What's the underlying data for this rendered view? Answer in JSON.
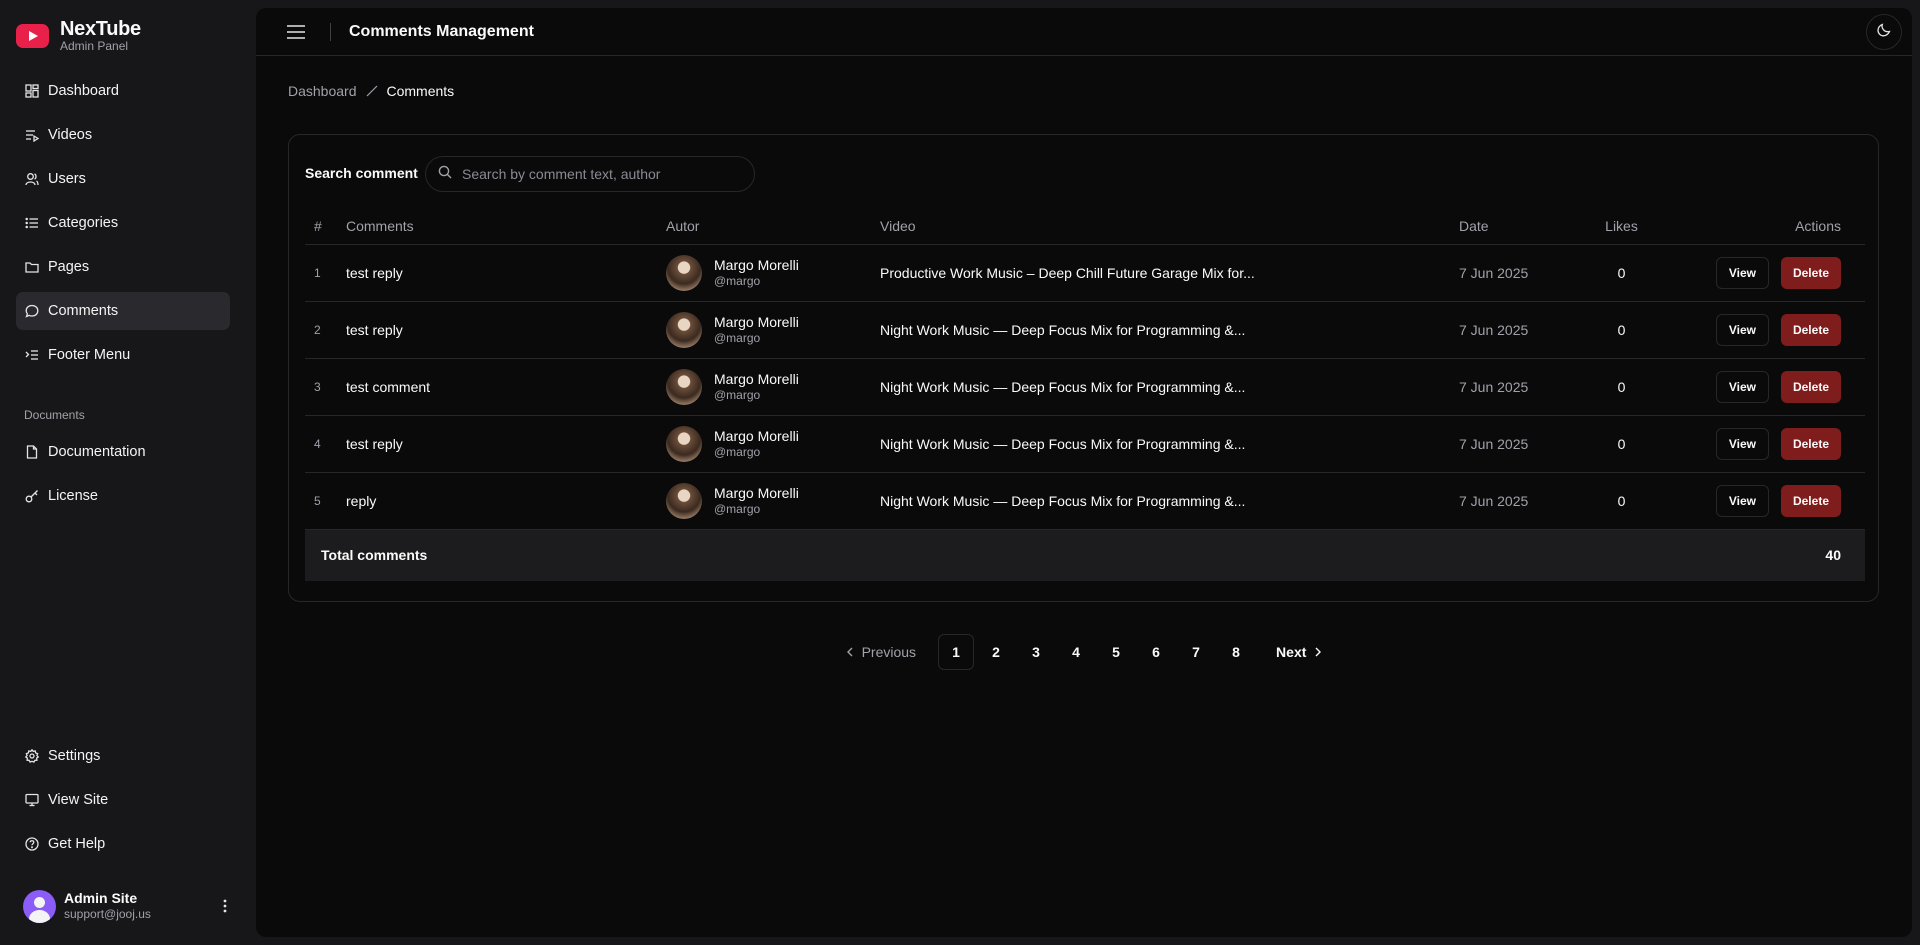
{
  "brand": {
    "name": "NexTube",
    "subtitle": "Admin Panel"
  },
  "sidebar": {
    "items": [
      {
        "label": "Dashboard",
        "icon": "dashboard-icon"
      },
      {
        "label": "Videos",
        "icon": "videos-icon"
      },
      {
        "label": "Users",
        "icon": "users-icon"
      },
      {
        "label": "Categories",
        "icon": "categories-icon"
      },
      {
        "label": "Pages",
        "icon": "folder-icon"
      },
      {
        "label": "Comments",
        "icon": "comment-icon",
        "active": true
      },
      {
        "label": "Footer Menu",
        "icon": "footer-menu-icon"
      }
    ],
    "documents_label": "Documents",
    "documents": [
      {
        "label": "Documentation",
        "icon": "document-icon"
      },
      {
        "label": "License",
        "icon": "key-icon"
      }
    ],
    "bottom": [
      {
        "label": "Settings",
        "icon": "gear-icon"
      },
      {
        "label": "View Site",
        "icon": "monitor-icon"
      },
      {
        "label": "Get Help",
        "icon": "help-icon"
      }
    ],
    "user": {
      "name": "Admin Site",
      "email": "support@jooj.us"
    }
  },
  "header": {
    "title": "Comments Management"
  },
  "breadcrumb": {
    "parent": "Dashboard",
    "current": "Comments"
  },
  "search": {
    "label": "Search comment",
    "placeholder": "Search by comment text, author"
  },
  "table": {
    "columns": [
      "#",
      "Comments",
      "Autor",
      "Video",
      "Date",
      "Likes",
      "Actions"
    ],
    "rows": [
      {
        "num": "1",
        "comment": "test reply",
        "author": "Margo Morelli",
        "handle": "@margo",
        "video": "Productive Work Music – Deep Chill Future Garage Mix for...",
        "date": "7 Jun 2025",
        "likes": "0"
      },
      {
        "num": "2",
        "comment": "test reply",
        "author": "Margo Morelli",
        "handle": "@margo",
        "video": "Night Work Music — Deep Focus Mix for Programming &...",
        "date": "7 Jun 2025",
        "likes": "0"
      },
      {
        "num": "3",
        "comment": "test comment",
        "author": "Margo Morelli",
        "handle": "@margo",
        "video": "Night Work Music — Deep Focus Mix for Programming &...",
        "date": "7 Jun 2025",
        "likes": "0"
      },
      {
        "num": "4",
        "comment": "test reply",
        "author": "Margo Morelli",
        "handle": "@margo",
        "video": "Night Work Music — Deep Focus Mix for Programming &...",
        "date": "7 Jun 2025",
        "likes": "0"
      },
      {
        "num": "5",
        "comment": "reply",
        "author": "Margo Morelli",
        "handle": "@margo",
        "video": "Night Work Music — Deep Focus Mix for Programming &...",
        "date": "7 Jun 2025",
        "likes": "0"
      }
    ],
    "view_label": "View",
    "delete_label": "Delete",
    "total_label": "Total comments",
    "total_value": "40"
  },
  "pagination": {
    "previous": "Previous",
    "next": "Next",
    "pages": [
      "1",
      "2",
      "3",
      "4",
      "5",
      "6",
      "7",
      "8"
    ],
    "current": "1"
  },
  "colors": {
    "brand": "#e8204a",
    "delete": "#7f1d1d",
    "active_nav": "#2a2a2e",
    "avatar": "#8b5cf6"
  }
}
